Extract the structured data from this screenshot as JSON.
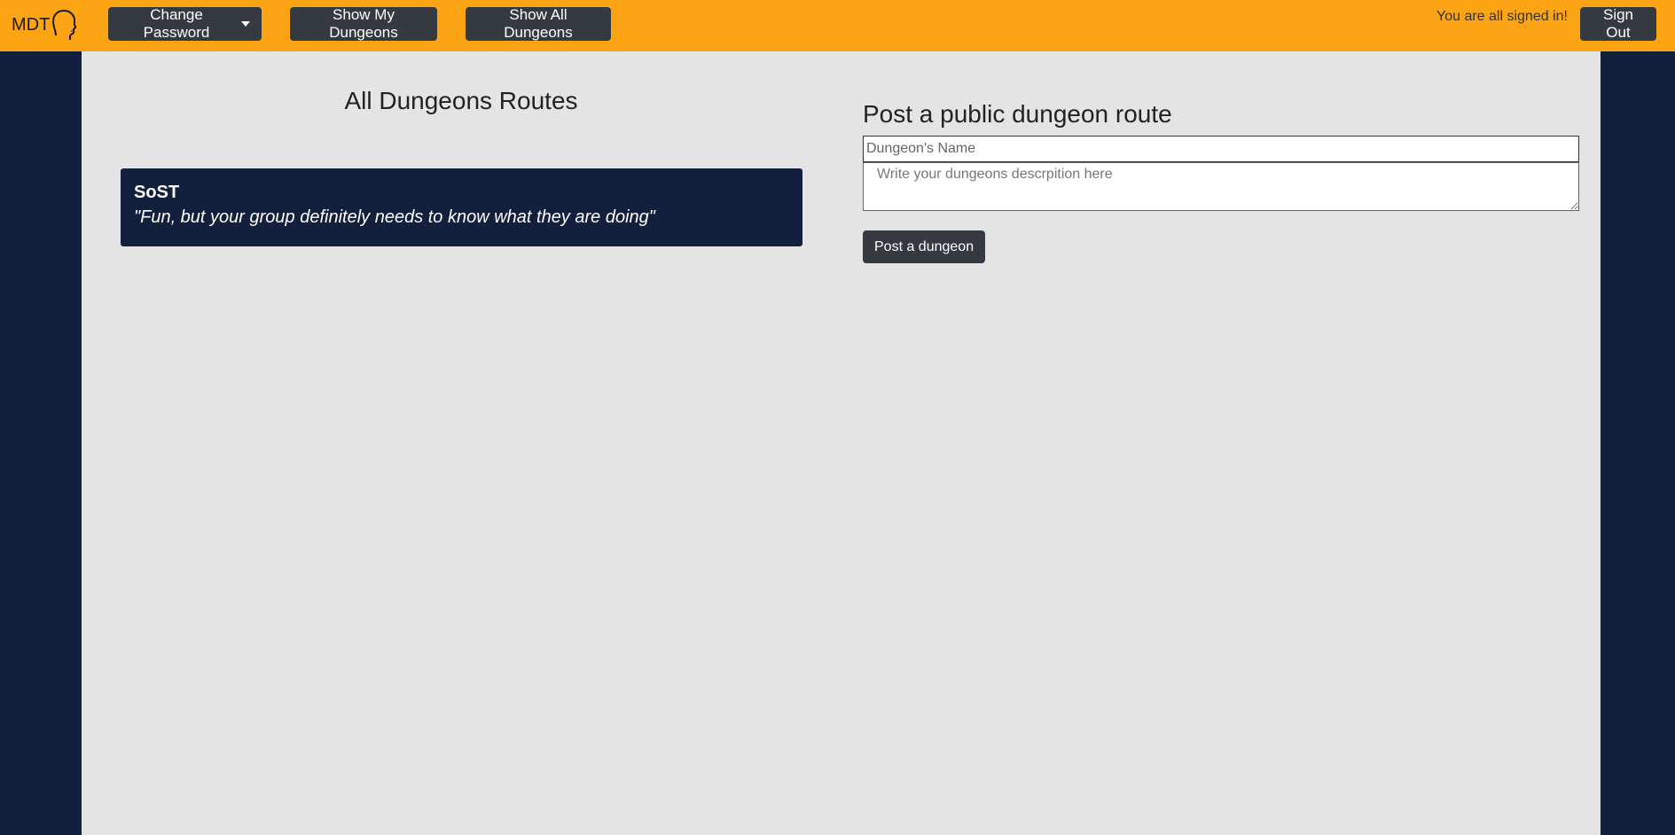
{
  "brand": {
    "text": "MDT",
    "logo_icon": "head-profile-icon"
  },
  "navbar": {
    "change_password_label": "Change Password",
    "show_my_dungeons_label": "Show My Dungeons",
    "show_all_dungeons_label": "Show All Dungeons",
    "signed_in_message": "You are all signed in!",
    "sign_out_label": "Sign Out",
    "colors": {
      "bar": "#fca414",
      "button": "#343a40",
      "page": "#13203d"
    }
  },
  "dungeon_list": {
    "title": "All Dungeons Routes",
    "items": [
      {
        "name": "SoST",
        "description": "\"Fun, but your group definitely needs to know what they are doing\""
      }
    ]
  },
  "post_form": {
    "title": "Post a public dungeon route",
    "name_placeholder": "Dungeon's Name",
    "description_placeholder": "Write your dungeons descrpition here",
    "submit_label": "Post a dungeon"
  }
}
